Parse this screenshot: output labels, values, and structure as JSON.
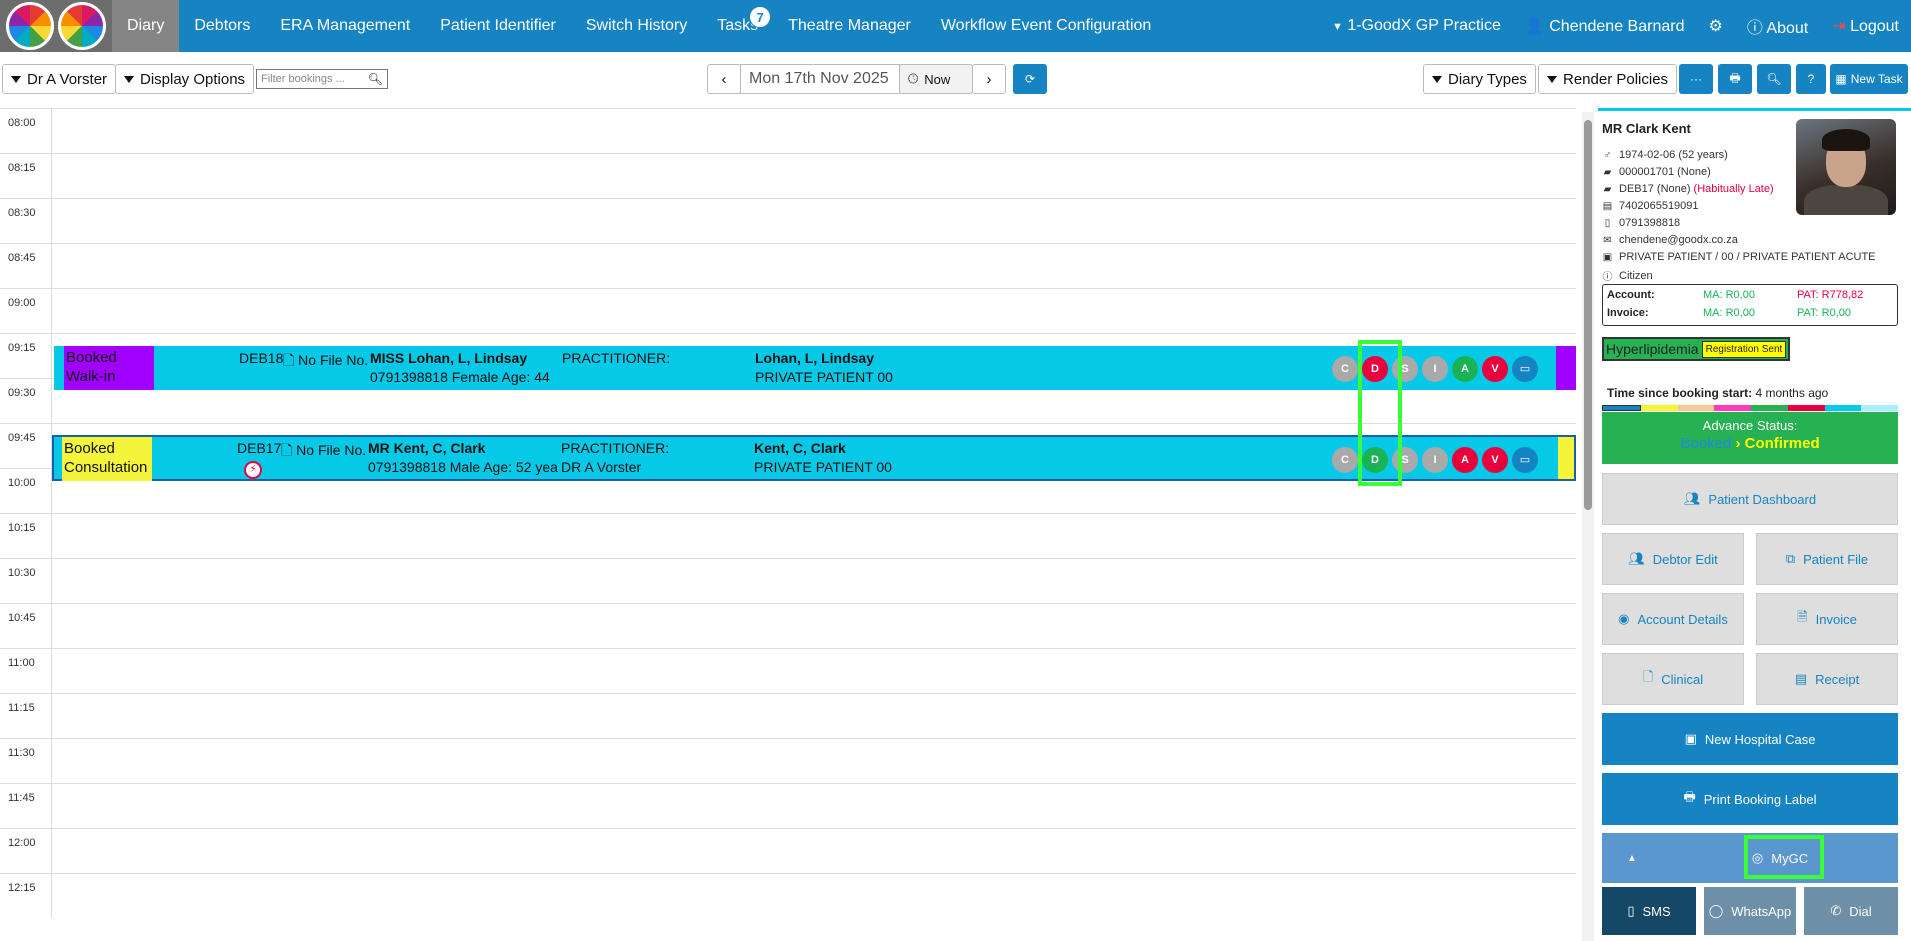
{
  "nav": {
    "items": [
      {
        "label": "Diary",
        "active": true
      },
      {
        "label": "Debtors"
      },
      {
        "label": "ERA Management"
      },
      {
        "label": "Patient Identifier"
      },
      {
        "label": "Switch History"
      },
      {
        "label": "Tasks",
        "badge": "7"
      },
      {
        "label": "Theatre Manager"
      },
      {
        "label": "Workflow Event Configuration"
      }
    ],
    "practice": "1-GoodX GP Practice",
    "user": "Chendene Barnard",
    "about": "About",
    "logout": "Logout"
  },
  "toolbar": {
    "doctor": "Dr A Vorster",
    "display_options": "Display Options",
    "filter_placeholder": "Filter bookings ...",
    "date": "Mon 17th Nov 2025",
    "now": "Now",
    "diary_types": "Diary Types",
    "render_policies": "Render Policies",
    "more": "···",
    "help": "?",
    "new_task": "New Task"
  },
  "slots": [
    "08:00",
    "08:15",
    "08:30",
    "08:45",
    "09:00",
    "09:15",
    "09:30",
    "09:45",
    "10:00",
    "10:15",
    "10:30",
    "10:45",
    "11:00",
    "11:15",
    "11:30",
    "11:45",
    "12:00",
    "12:15"
  ],
  "bookings": [
    {
      "status_line1": "Booked",
      "status_line2": "Walk-in",
      "status_color": "#a000ff",
      "end_color": "#a000ff",
      "debtor": "DEB18",
      "file": "No File No.",
      "name": "MISS Lohan, L, Lindsay",
      "details": "0791398818 Female Age: 44",
      "practitioner_label": "PRACTITIONER:",
      "practitioner": "",
      "patient": "Lohan, L, Lindsay",
      "plan": "PRIVATE PATIENT 00",
      "circles": [
        {
          "letter": "C",
          "color": "#a9a9a9"
        },
        {
          "letter": "D",
          "color": "#e8003d"
        },
        {
          "letter": "S",
          "color": "#a9a9a9"
        },
        {
          "letter": "I",
          "color": "#a9a9a9"
        },
        {
          "letter": "A",
          "color": "#19b255"
        },
        {
          "letter": "V",
          "color": "#e8003d"
        }
      ]
    },
    {
      "status_line1": "Booked",
      "status_line2": "Consultation",
      "status_color": "#f4f43a",
      "end_color": "#f4f43a",
      "debtor": "DEB17",
      "file": "No File No.",
      "name": "MR Kent, C, Clark",
      "details": "0791398818 Male Age: 52 yea",
      "practitioner_label": "PRACTITIONER:",
      "practitioner": "DR A Vorster",
      "patient": "Kent, C, Clark",
      "plan": "PRIVATE PATIENT 00",
      "circles": [
        {
          "letter": "C",
          "color": "#a9a9a9"
        },
        {
          "letter": "D",
          "color": "#19b255"
        },
        {
          "letter": "S",
          "color": "#a9a9a9"
        },
        {
          "letter": "I",
          "color": "#a9a9a9"
        },
        {
          "letter": "A",
          "color": "#e8003d"
        },
        {
          "letter": "V",
          "color": "#e8003d"
        }
      ]
    }
  ],
  "patient": {
    "name": "MR Clark Kent",
    "dob": "1974-02-06 (52 years)",
    "file": "000001701 (None)",
    "debtor": "DEB17 (None)",
    "debtor_flag": "(Habitually Late)",
    "id_number": "7402065519091",
    "phone": "0791398818",
    "email": "chendene@goodx.co.za",
    "plan": "PRIVATE PATIENT / 00 / PRIVATE PATIENT ACUTE",
    "citizenship": "Citizen",
    "account_label": "Account:",
    "invoice_label": "Invoice:",
    "account_ma": "MA: R0,00",
    "account_pat": "PAT: R778,82",
    "invoice_ma": "MA: R0,00",
    "invoice_pat": "PAT: R0,00",
    "condition": "Hyperlipidemia",
    "condition_tag": "Registration Sent",
    "time_label": "Time since booking start:",
    "time_value": "4 months ago",
    "advance_label": "Advance Status:",
    "advance_from": "Booked",
    "advance_to": "Confirmed"
  },
  "actions": {
    "patient_dashboard": "Patient Dashboard",
    "debtor_edit": "Debtor Edit",
    "patient_file": "Patient File",
    "account_details": "Account Details",
    "invoice": "Invoice",
    "clinical": "Clinical",
    "receipt": "Receipt",
    "new_hospital_case": "New Hospital Case",
    "print_booking_label": "Print Booking Label",
    "mygc": "MyGC",
    "sms": "SMS",
    "whatsapp": "WhatsApp",
    "dial": "Dial"
  }
}
